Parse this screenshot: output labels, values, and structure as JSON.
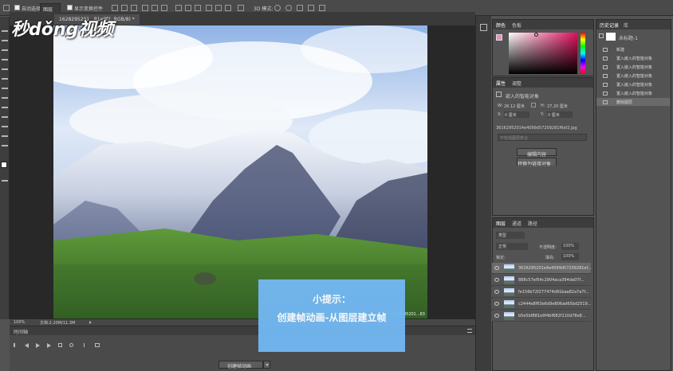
{
  "options_bar": {
    "auto_select_label": "自动选择：",
    "auto_select_value": "图层",
    "show_transform_label": "显示变换控件"
  },
  "document": {
    "tab_label": "1628295201...81e9f2, RGB/8) *"
  },
  "watermark": {
    "text": "秒dǒng视频"
  },
  "status_bar": {
    "zoom": "100%",
    "doc_info": "文档:2.20M/11.3M"
  },
  "photo": {
    "corner_text": "1628295201...83"
  },
  "timeline": {
    "title": "时间轴",
    "create_button": "创建帧动画",
    "controls": [
      "first-frame",
      "prev-frame",
      "play",
      "next-frame",
      "audio",
      "settings",
      "split",
      "transition"
    ]
  },
  "tip": {
    "title": "小提示：",
    "body": "创建帧动画-从图层建立帧"
  },
  "color_panel": {
    "tabs": [
      "颜色",
      "色板"
    ]
  },
  "properties_panel": {
    "tabs": [
      "属性",
      "调整"
    ],
    "type_label": "嵌入的智能对象",
    "w_label": "W:",
    "w_value": "26.12 厘米",
    "h_label": "H:",
    "h_value": "27.20 厘米",
    "x_label": "X:",
    "x_value": "0 厘米",
    "y_label": "Y:",
    "y_value": "0 厘米",
    "filename": "36162952014e4099d57209281f6ef2.jpg",
    "comp_placeholder": "不包括图层复合",
    "edit_button": "编辑内容",
    "convert_button": "转换为链接对象..."
  },
  "layers_panel": {
    "tabs": [
      "图层",
      "通道",
      "路径"
    ],
    "filter_label": "类型",
    "blend_mode": "正常",
    "opacity_label": "不透明度:",
    "opacity_value": "100%",
    "lock_label": "锁定:",
    "fill_label": "填充:",
    "fill_value": "100%",
    "layers": [
      "3616295201e4e4099d57209281ef...",
      "888c57ef54c2904aca394da07f...",
      "fe156b72f277474d91baa82a7a7f...",
      "c2444e8f63e6d9e806ad65bd2519...",
      "b5e5bf881e9f4bf682f110d78e8..."
    ]
  },
  "history_panel": {
    "tabs": [
      "历史记录",
      "库"
    ],
    "doc_name": "未标题-1",
    "items": [
      "新建",
      "置入嵌入的智能对象",
      "置入嵌入的智能对象",
      "置入嵌入的智能对象",
      "置入嵌入的智能对象",
      "置入嵌入的智能对象",
      "删除图层"
    ]
  },
  "colors": {
    "tip_bg": "#72b7f2",
    "panel_bg": "#535353",
    "dark_bg": "#282828",
    "selected_row": "#6a6a6a"
  }
}
